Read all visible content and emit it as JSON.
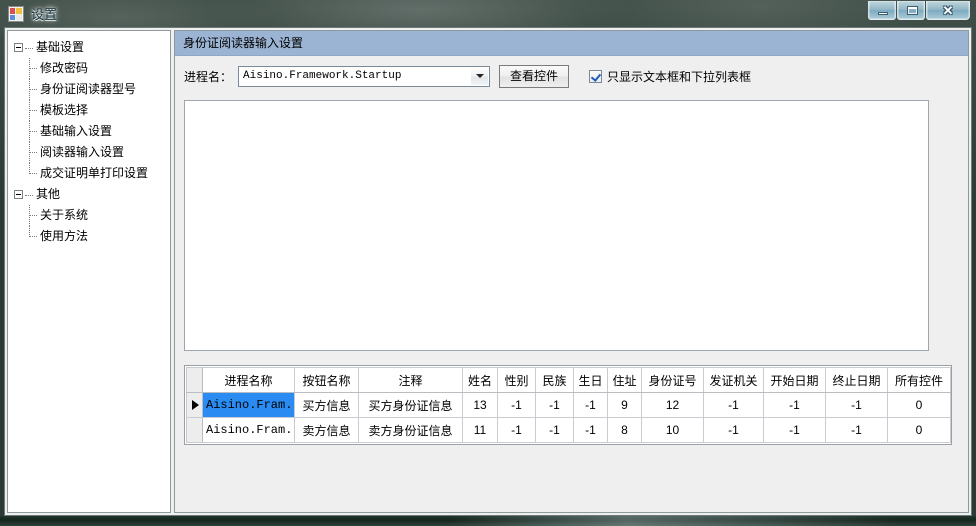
{
  "window": {
    "title": "设置",
    "icon": "app-grid-icon",
    "buttons": {
      "minimize": "最小化",
      "maximize": "最大化",
      "close": "关闭"
    }
  },
  "sidebar": {
    "groups": [
      {
        "label": "基础设置",
        "expanded": true,
        "items": [
          {
            "label": "修改密码"
          },
          {
            "label": "身份证阅读器型号"
          },
          {
            "label": "模板选择"
          },
          {
            "label": "基础输入设置"
          },
          {
            "label": "阅读器输入设置"
          },
          {
            "label": "成交证明单打印设置"
          }
        ]
      },
      {
        "label": "其他",
        "expanded": true,
        "items": [
          {
            "label": "关于系统"
          },
          {
            "label": "使用方法"
          }
        ]
      }
    ]
  },
  "content": {
    "header": "身份证阅读器输入设置",
    "toolbar": {
      "process_label": "进程名：",
      "process_value": "Aisino.Framework.Startup",
      "view_controls_button": "查看控件",
      "filter_checkbox_label": "只显示文本框和下拉列表框",
      "filter_checkbox_checked": true
    },
    "controls_list": {
      "items": []
    },
    "grid": {
      "columns": [
        "进程名称",
        "按钮名称",
        "注释",
        "姓名",
        "性别",
        "民族",
        "生日",
        "住址",
        "身份证号",
        "发证机关",
        "开始日期",
        "终止日期",
        "所有控件"
      ],
      "rows": [
        {
          "current": true,
          "cells": [
            "Aisino.Fram...",
            "买方信息",
            "买方身份证信息",
            "13",
            "-1",
            "-1",
            "-1",
            "9",
            "12",
            "-1",
            "-1",
            "-1",
            "0"
          ]
        },
        {
          "current": false,
          "cells": [
            "Aisino.Fram...",
            "卖方信息",
            "卖方身份证信息",
            "11",
            "-1",
            "-1",
            "-1",
            "8",
            "10",
            "-1",
            "-1",
            "-1",
            "0"
          ]
        }
      ]
    }
  },
  "colors": {
    "header_blue": "#9cb4d3",
    "selection_blue": "#2a8bf2",
    "titlebar_glass": "#5f8a9c"
  }
}
